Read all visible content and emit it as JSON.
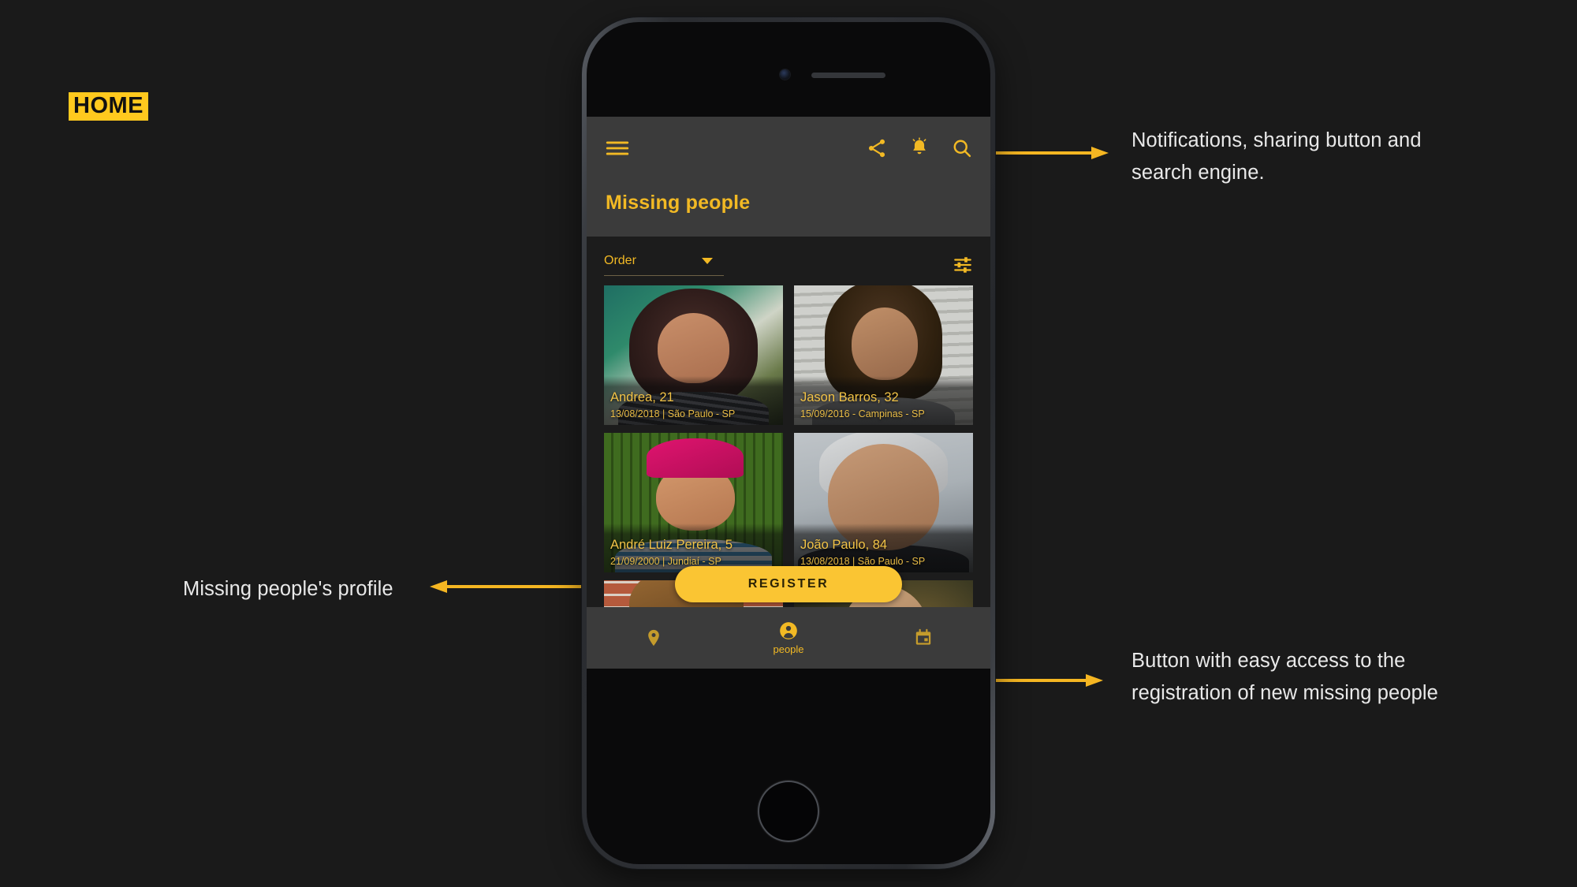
{
  "page": {
    "section_label": "HOME",
    "background_color": "#1a1a1a",
    "accent_color": "#F2B924"
  },
  "annotations": [
    {
      "id": "top",
      "text": "Notifications, sharing button and search engine.",
      "arrow_direction": "right"
    },
    {
      "id": "middle",
      "text": "Missing people's profile",
      "arrow_direction": "left"
    },
    {
      "id": "bottom",
      "text": "Button with easy access to the registration of new missing people",
      "arrow_direction": "right"
    }
  ],
  "app": {
    "appbar": {
      "menu_icon": "hamburger-menu-icon",
      "title": "Missing people",
      "actions": [
        {
          "name": "share-icon",
          "label": "Share"
        },
        {
          "name": "bell-icon",
          "label": "Notifications"
        },
        {
          "name": "search-icon",
          "label": "Search"
        }
      ]
    },
    "filters": {
      "order_label": "Order",
      "order_caret_icon": "chevron-down-icon",
      "tune_icon": "tune-filter-icon"
    },
    "cards": [
      {
        "name": "Andrea, 21",
        "meta": "13/08/2018 | São Paulo - SP",
        "photo": "andrea"
      },
      {
        "name": "Jason Barros, 32",
        "meta": "15/09/2016 - Campinas - SP",
        "photo": "jason"
      },
      {
        "name": "André Luiz Pereira, 5",
        "meta": "21/09/2000  |  Jundiaí - SP",
        "photo": "andre"
      },
      {
        "name": "João Paulo, 84",
        "meta": "13/08/2018 | São Paulo - SP",
        "photo": "joao"
      },
      {
        "name": "",
        "meta": "",
        "photo": "brick"
      },
      {
        "name": "",
        "meta": "",
        "photo": "bald"
      }
    ],
    "register_button": {
      "label": "REGISTER",
      "color": "#FAC533"
    },
    "bottom_nav": [
      {
        "name": "location-pin-icon",
        "label": "",
        "active": false
      },
      {
        "name": "person-icon",
        "label": "people",
        "active": true
      },
      {
        "name": "calendar-icon",
        "label": "",
        "active": false
      }
    ]
  }
}
